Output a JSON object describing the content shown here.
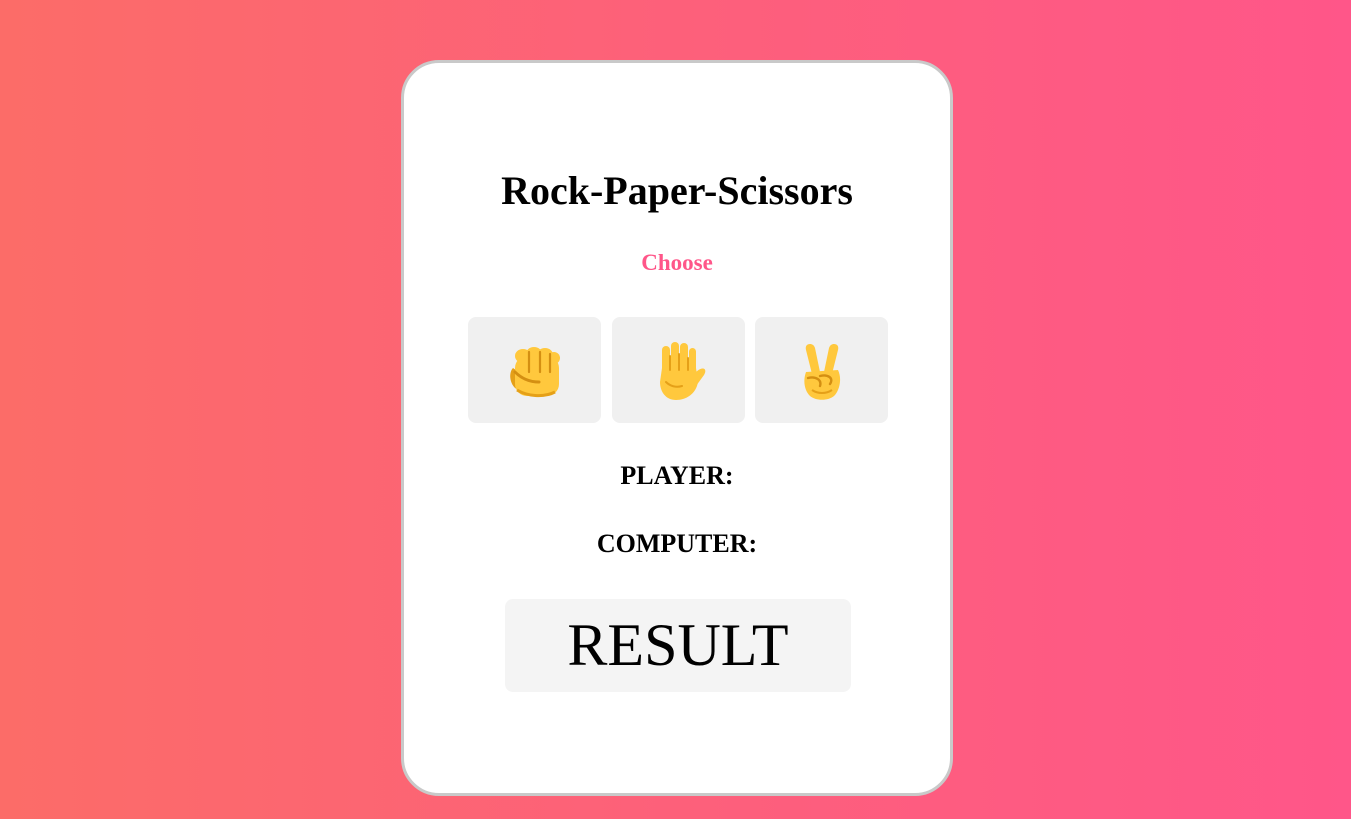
{
  "game": {
    "title": "Rock-Paper-Scissors",
    "prompt": "Choose",
    "choices": [
      {
        "icon": "fist-icon",
        "name": "rock"
      },
      {
        "icon": "raised-hand-icon",
        "name": "paper"
      },
      {
        "icon": "victory-hand-icon",
        "name": "scissors"
      }
    ],
    "player_label": "PLAYER:",
    "computer_label": "COMPUTER:",
    "result_text": "RESULT"
  },
  "colors": {
    "background_start": "#fc6c68",
    "background_end": "#ff5689",
    "accent": "#ff5689",
    "button_bg": "#f0f0f0",
    "emoji_yellow": "#ffc83d"
  }
}
